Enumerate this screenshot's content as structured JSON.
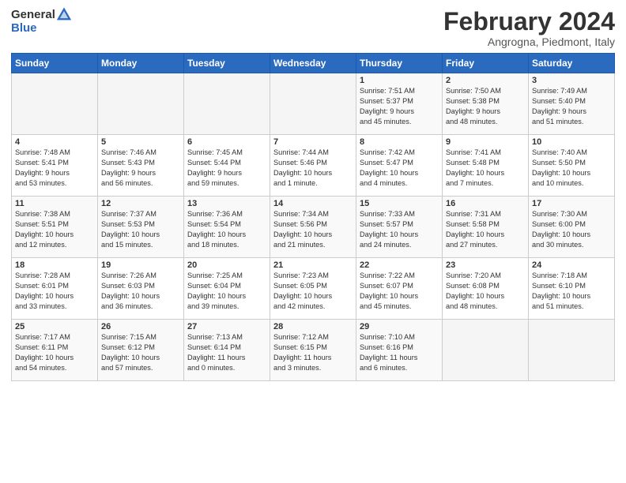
{
  "logo": {
    "general": "General",
    "blue": "Blue"
  },
  "header": {
    "month": "February 2024",
    "location": "Angrogna, Piedmont, Italy"
  },
  "days_of_week": [
    "Sunday",
    "Monday",
    "Tuesday",
    "Wednesday",
    "Thursday",
    "Friday",
    "Saturday"
  ],
  "weeks": [
    [
      {
        "day": "",
        "info": ""
      },
      {
        "day": "",
        "info": ""
      },
      {
        "day": "",
        "info": ""
      },
      {
        "day": "",
        "info": ""
      },
      {
        "day": "1",
        "info": "Sunrise: 7:51 AM\nSunset: 5:37 PM\nDaylight: 9 hours\nand 45 minutes."
      },
      {
        "day": "2",
        "info": "Sunrise: 7:50 AM\nSunset: 5:38 PM\nDaylight: 9 hours\nand 48 minutes."
      },
      {
        "day": "3",
        "info": "Sunrise: 7:49 AM\nSunset: 5:40 PM\nDaylight: 9 hours\nand 51 minutes."
      }
    ],
    [
      {
        "day": "4",
        "info": "Sunrise: 7:48 AM\nSunset: 5:41 PM\nDaylight: 9 hours\nand 53 minutes."
      },
      {
        "day": "5",
        "info": "Sunrise: 7:46 AM\nSunset: 5:43 PM\nDaylight: 9 hours\nand 56 minutes."
      },
      {
        "day": "6",
        "info": "Sunrise: 7:45 AM\nSunset: 5:44 PM\nDaylight: 9 hours\nand 59 minutes."
      },
      {
        "day": "7",
        "info": "Sunrise: 7:44 AM\nSunset: 5:46 PM\nDaylight: 10 hours\nand 1 minute."
      },
      {
        "day": "8",
        "info": "Sunrise: 7:42 AM\nSunset: 5:47 PM\nDaylight: 10 hours\nand 4 minutes."
      },
      {
        "day": "9",
        "info": "Sunrise: 7:41 AM\nSunset: 5:48 PM\nDaylight: 10 hours\nand 7 minutes."
      },
      {
        "day": "10",
        "info": "Sunrise: 7:40 AM\nSunset: 5:50 PM\nDaylight: 10 hours\nand 10 minutes."
      }
    ],
    [
      {
        "day": "11",
        "info": "Sunrise: 7:38 AM\nSunset: 5:51 PM\nDaylight: 10 hours\nand 12 minutes."
      },
      {
        "day": "12",
        "info": "Sunrise: 7:37 AM\nSunset: 5:53 PM\nDaylight: 10 hours\nand 15 minutes."
      },
      {
        "day": "13",
        "info": "Sunrise: 7:36 AM\nSunset: 5:54 PM\nDaylight: 10 hours\nand 18 minutes."
      },
      {
        "day": "14",
        "info": "Sunrise: 7:34 AM\nSunset: 5:56 PM\nDaylight: 10 hours\nand 21 minutes."
      },
      {
        "day": "15",
        "info": "Sunrise: 7:33 AM\nSunset: 5:57 PM\nDaylight: 10 hours\nand 24 minutes."
      },
      {
        "day": "16",
        "info": "Sunrise: 7:31 AM\nSunset: 5:58 PM\nDaylight: 10 hours\nand 27 minutes."
      },
      {
        "day": "17",
        "info": "Sunrise: 7:30 AM\nSunset: 6:00 PM\nDaylight: 10 hours\nand 30 minutes."
      }
    ],
    [
      {
        "day": "18",
        "info": "Sunrise: 7:28 AM\nSunset: 6:01 PM\nDaylight: 10 hours\nand 33 minutes."
      },
      {
        "day": "19",
        "info": "Sunrise: 7:26 AM\nSunset: 6:03 PM\nDaylight: 10 hours\nand 36 minutes."
      },
      {
        "day": "20",
        "info": "Sunrise: 7:25 AM\nSunset: 6:04 PM\nDaylight: 10 hours\nand 39 minutes."
      },
      {
        "day": "21",
        "info": "Sunrise: 7:23 AM\nSunset: 6:05 PM\nDaylight: 10 hours\nand 42 minutes."
      },
      {
        "day": "22",
        "info": "Sunrise: 7:22 AM\nSunset: 6:07 PM\nDaylight: 10 hours\nand 45 minutes."
      },
      {
        "day": "23",
        "info": "Sunrise: 7:20 AM\nSunset: 6:08 PM\nDaylight: 10 hours\nand 48 minutes."
      },
      {
        "day": "24",
        "info": "Sunrise: 7:18 AM\nSunset: 6:10 PM\nDaylight: 10 hours\nand 51 minutes."
      }
    ],
    [
      {
        "day": "25",
        "info": "Sunrise: 7:17 AM\nSunset: 6:11 PM\nDaylight: 10 hours\nand 54 minutes."
      },
      {
        "day": "26",
        "info": "Sunrise: 7:15 AM\nSunset: 6:12 PM\nDaylight: 10 hours\nand 57 minutes."
      },
      {
        "day": "27",
        "info": "Sunrise: 7:13 AM\nSunset: 6:14 PM\nDaylight: 11 hours\nand 0 minutes."
      },
      {
        "day": "28",
        "info": "Sunrise: 7:12 AM\nSunset: 6:15 PM\nDaylight: 11 hours\nand 3 minutes."
      },
      {
        "day": "29",
        "info": "Sunrise: 7:10 AM\nSunset: 6:16 PM\nDaylight: 11 hours\nand 6 minutes."
      },
      {
        "day": "",
        "info": ""
      },
      {
        "day": "",
        "info": ""
      }
    ]
  ]
}
